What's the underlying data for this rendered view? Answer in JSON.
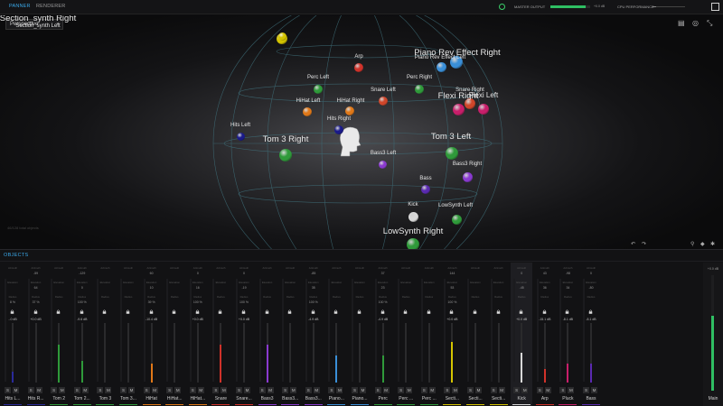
{
  "tabs": [
    {
      "label": "PANNER",
      "active": true
    },
    {
      "label": "RENDERER",
      "active": false
    }
  ],
  "topbar": {
    "master_label": "MASTER OUTPUT",
    "master_value": "+0.0 dB",
    "master_level": 0.88,
    "cpu_label": "CPU PERFORMANCE",
    "cpu_level": 0.1
  },
  "viewport": {
    "view_mode": "Perspective",
    "object_count": "46/128 total objects",
    "icons": [
      "grid-icon",
      "eye-off-icon",
      "collapse-icon"
    ]
  },
  "objects3d": [
    {
      "label": "Section_synth Right",
      "color": "#d4c400",
      "size": "big"
    },
    {
      "label": "Section_synth Left",
      "color": "#d4c400",
      "size": "small"
    },
    {
      "label": "Arp",
      "color": "#d0322a",
      "size": "small"
    },
    {
      "label": "Piano Rev Effect Right",
      "color": "#3a8fd8",
      "size": "big"
    },
    {
      "label": "Piano Rev Effect Left",
      "color": "#3a8fd8",
      "size": "small"
    },
    {
      "label": "Perc Left",
      "color": "#2f9a3a",
      "size": "small"
    },
    {
      "label": "Perc Right",
      "color": "#2f9a3a",
      "size": "small"
    },
    {
      "label": "Snare Left",
      "color": "#d0462a",
      "size": "small"
    },
    {
      "label": "HiHat Left",
      "color": "#e07818",
      "size": "small"
    },
    {
      "label": "HiHat Right",
      "color": "#e07818",
      "size": "small"
    },
    {
      "label": "Hits Right",
      "color": "#1a1a8a",
      "size": "small"
    },
    {
      "label": "Hits Left",
      "color": "#1a1a8a",
      "size": "small"
    },
    {
      "label": "Snare Right",
      "color": "#d0462a",
      "size": "small"
    },
    {
      "label": "Flexi Right",
      "color": "#c81e6a",
      "size": "big"
    },
    {
      "label": "Flexi Left",
      "color": "#c81e6a",
      "size": "mid"
    },
    {
      "label": "Tom  3 Right",
      "color": "#2f9a3a",
      "size": "big"
    },
    {
      "label": "Tom  3 Left",
      "color": "#2f9a3a",
      "size": "big"
    },
    {
      "label": "Bass3 Left",
      "color": "#8a3ad0",
      "size": "small"
    },
    {
      "label": "Bass3 Right",
      "color": "#8a3ad0",
      "size": "small"
    },
    {
      "label": "Bass",
      "color": "#5a2ab0",
      "size": "small"
    },
    {
      "label": "Kick",
      "color": "#d8d8d8",
      "size": "small"
    },
    {
      "label": "LowSynth Left",
      "color": "#2f9a3a",
      "size": "small"
    },
    {
      "label": "LowSynth Right",
      "color": "#2f9a3a",
      "size": "big"
    }
  ],
  "mixer": {
    "title": "OBJECTS",
    "param_labels": [
      "Azimuth",
      "Elevation",
      "Radius"
    ],
    "strips": [
      {
        "name": "Hits L...",
        "az": "",
        "el": "",
        "rad": "8 %",
        "gain": "-.0 dB",
        "color": "#2a2a9a",
        "level": 0.2
      },
      {
        "name": "Hits R...",
        "az": "-59",
        "el": "64",
        "rad": "37 %",
        "gain": "+0.0 dB",
        "color": "#2a2a9a",
        "level": 0.0
      },
      {
        "name": "Tom  2",
        "az": "",
        "el": "",
        "rad": "",
        "gain": "",
        "color": "#2f9a3a",
        "level": 0.7
      },
      {
        "name": "Tom  2...",
        "az": "-129",
        "el": "0",
        "rad": "100 %",
        "gain": "-9.6 dB",
        "color": "#2f9a3a",
        "level": 0.4
      },
      {
        "name": "Tom  3",
        "az": "",
        "el": "",
        "rad": "",
        "gain": "",
        "color": "#2f9a3a",
        "level": 0.0
      },
      {
        "name": "Tom  3...",
        "az": "",
        "el": "",
        "rad": "",
        "gain": "",
        "color": "#2f9a3a",
        "level": 0.0
      },
      {
        "name": "HiHat",
        "az": "60",
        "el": "10",
        "rad": "39 %",
        "gain": "-10.4 dB",
        "color": "#e07818",
        "level": 0.35
      },
      {
        "name": "HiHat...",
        "az": "",
        "el": "",
        "rad": "",
        "gain": "",
        "color": "#e07818",
        "level": 0.0
      },
      {
        "name": "HiHat...",
        "az": "0",
        "el": "16",
        "rad": "100 %",
        "gain": "+0.0 dB",
        "color": "#e07818",
        "level": 0.0
      },
      {
        "name": "Snare",
        "az": "",
        "el": "",
        "rad": "",
        "gain": "",
        "color": "#d0322a",
        "level": 0.7
      },
      {
        "name": "Snare...",
        "az": "0",
        "el": "-19",
        "rad": "100 %",
        "gain": "+0.0 dB",
        "color": "#d0322a",
        "level": 0.0
      },
      {
        "name": "Bass3",
        "az": "",
        "el": "",
        "rad": "",
        "gain": "",
        "color": "#8a3ad0",
        "level": 0.7
      },
      {
        "name": "Bass3...",
        "az": "",
        "el": "",
        "rad": "",
        "gain": "",
        "color": "#8a3ad0",
        "level": 0.0
      },
      {
        "name": "Bass3...",
        "az": "-85",
        "el": "35",
        "rad": "100 %",
        "gain": "-4.9 dB",
        "color": "#8a3ad0",
        "level": 0.0
      },
      {
        "name": "Piano...",
        "az": "",
        "el": "",
        "rad": "",
        "gain": "",
        "color": "#3a8fd8",
        "level": 0.5
      },
      {
        "name": "Piano...",
        "az": "",
        "el": "",
        "rad": "",
        "gain": "",
        "color": "#3a8fd8",
        "level": 0.0
      },
      {
        "name": "Perc",
        "az": "37",
        "el": "23",
        "rad": "100 %",
        "gain": "-4.9 dB",
        "color": "#2f9a3a",
        "level": 0.5
      },
      {
        "name": "Perc ...",
        "az": "",
        "el": "",
        "rad": "",
        "gain": "",
        "color": "#2f9a3a",
        "level": 0.0
      },
      {
        "name": "Perc ...",
        "az": "",
        "el": "",
        "rad": "",
        "gain": "",
        "color": "#2f9a3a",
        "level": 0.0
      },
      {
        "name": "Secti...",
        "az": "144",
        "el": "53",
        "rad": "100 %",
        "gain": "+0.0 dB",
        "color": "#d4c400",
        "level": 0.75
      },
      {
        "name": "Secti...",
        "az": "",
        "el": "",
        "rad": "",
        "gain": "",
        "color": "#d4c400",
        "level": 0.0
      },
      {
        "name": "Secti...",
        "az": "",
        "el": "",
        "rad": "",
        "gain": "",
        "color": "#d4c400",
        "level": 0.0
      },
      {
        "name": "Kick",
        "az": "0",
        "el": "-45",
        "rad": "",
        "gain": "+0.0 dB",
        "color": "#d8d8d8",
        "level": 0.55,
        "hl": true
      },
      {
        "name": "Arp",
        "az": "43",
        "el": "36",
        "rad": "",
        "gain": "-15.1 dB",
        "color": "#d0322a",
        "level": 0.25
      },
      {
        "name": "Pluck",
        "az": "-98",
        "el": "34",
        "rad": "",
        "gain": "-8.1 dB",
        "color": "#c81e6a",
        "level": 0.35
      },
      {
        "name": "Bass",
        "az": "0",
        "el": "-80",
        "rad": "",
        "gain": "-8.1 dB",
        "color": "#5a2ab0",
        "level": 0.35
      }
    ],
    "main": {
      "name": "Main",
      "value": "+0.0 dB",
      "level": 0.65
    }
  }
}
